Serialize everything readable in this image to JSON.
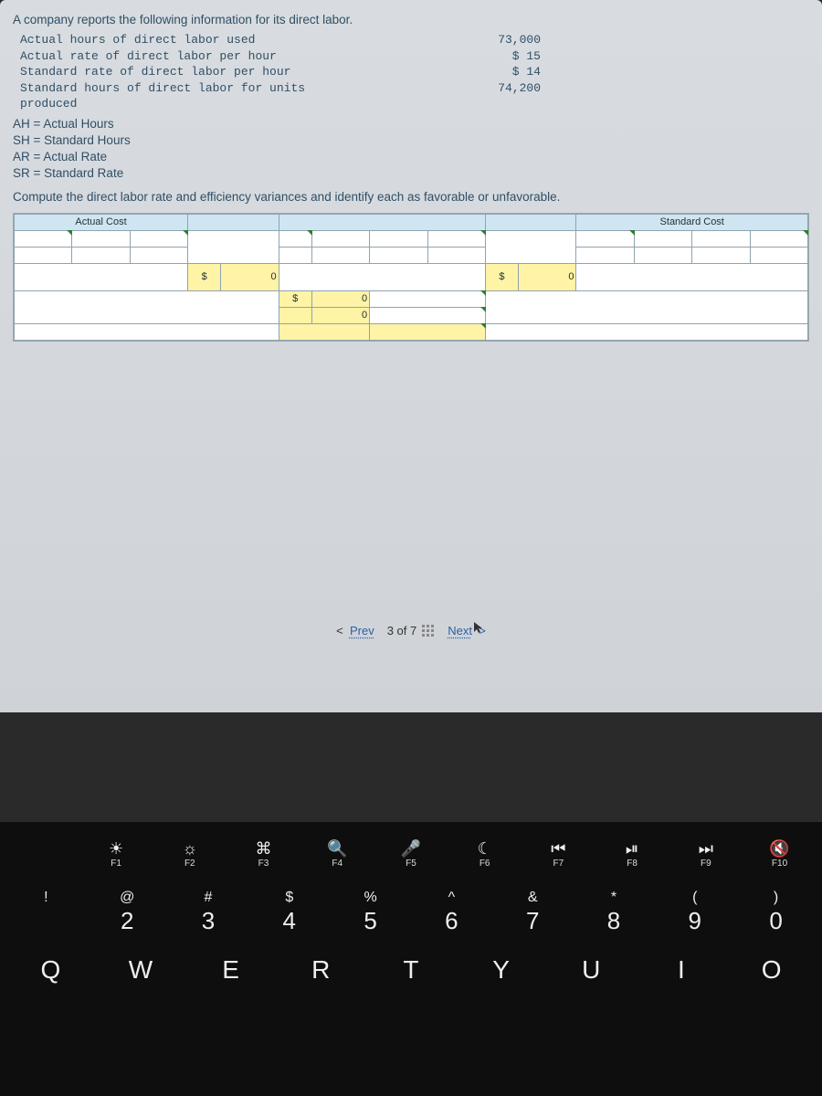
{
  "problem": {
    "intro": "A company reports the following information for its direct labor.",
    "labels": {
      "l1": "Actual hours of direct labor used",
      "l2": "Actual rate of direct labor per hour",
      "l3": "Standard rate of direct labor per hour",
      "l4": "Standard hours of direct labor for units produced"
    },
    "values": {
      "v1": "73,000",
      "v2": "$ 15",
      "v3": "$ 14",
      "v4": "74,200"
    },
    "defs": {
      "d1": "AH = Actual Hours",
      "d2": "SH = Standard Hours",
      "d3": "AR = Actual Rate",
      "d4": "SR = Standard Rate"
    },
    "instruction": "Compute the direct labor rate and efficiency variances and identify each as favorable or unfavorable."
  },
  "worksheet": {
    "header_actual": "Actual Cost",
    "header_standard": "Standard Cost",
    "dollar": "$",
    "zero": "0"
  },
  "nav": {
    "prev": "Prev",
    "pager": "3 of 7",
    "next": "Next"
  },
  "keyboard": {
    "fn": [
      {
        "glyph": "",
        "label": ""
      },
      {
        "glyph": "☀",
        "label": "F1"
      },
      {
        "glyph": "☼",
        "label": "F2"
      },
      {
        "glyph": "⌘",
        "label": "F3"
      },
      {
        "glyph": "🔍",
        "label": "F4"
      },
      {
        "glyph": "🎤",
        "label": "F5"
      },
      {
        "glyph": "☾",
        "label": "F6"
      },
      {
        "glyph": "⏮",
        "label": "F7"
      },
      {
        "glyph": "⏯",
        "label": "F8"
      },
      {
        "glyph": "⏭",
        "label": "F9"
      },
      {
        "glyph": "🔇",
        "label": "F10"
      }
    ],
    "nums": [
      {
        "sym": "!",
        "num": ""
      },
      {
        "sym": "@",
        "num": "2"
      },
      {
        "sym": "#",
        "num": "3"
      },
      {
        "sym": "$",
        "num": "4"
      },
      {
        "sym": "%",
        "num": "5"
      },
      {
        "sym": "^",
        "num": "6"
      },
      {
        "sym": "&",
        "num": "7"
      },
      {
        "sym": "*",
        "num": "8"
      },
      {
        "sym": "(",
        "num": "9"
      },
      {
        "sym": ")",
        "num": "0"
      }
    ],
    "letters": [
      "Q",
      "W",
      "E",
      "R",
      "T",
      "Y",
      "U",
      "I",
      "O"
    ]
  }
}
